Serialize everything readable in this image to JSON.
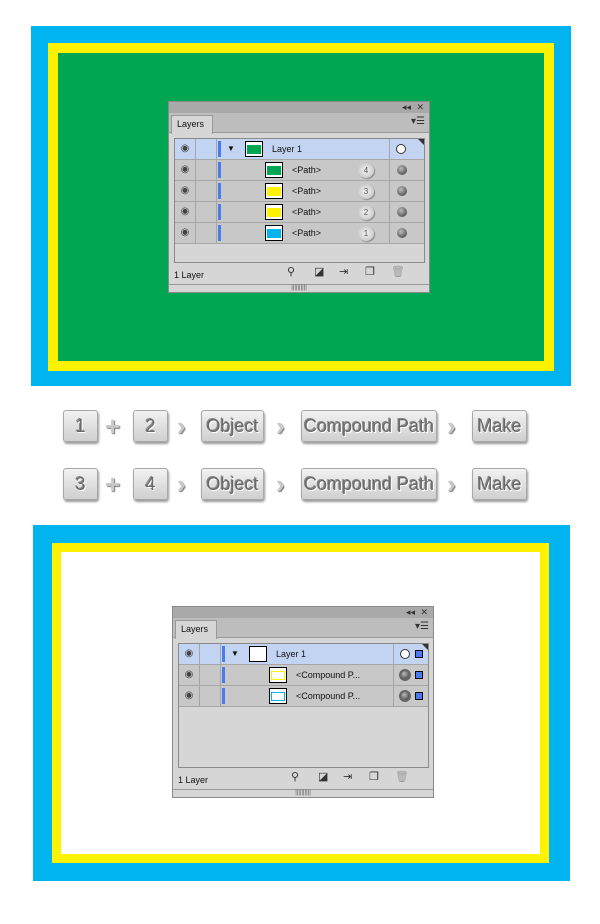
{
  "colors": {
    "blue": "#00b4f0",
    "yellow": "#fff200",
    "green": "#00a651",
    "white": "#ffffff",
    "layer_bar": "#4a7af0"
  },
  "panel_before": {
    "tab": "Layers",
    "footer": "1 Layer",
    "layer": {
      "name": "Layer 1",
      "thumb": "#00a651"
    },
    "rows": [
      {
        "name": "<Path>",
        "badge": "4",
        "thumb": "#00a651"
      },
      {
        "name": "<Path>",
        "badge": "3",
        "thumb": "#fff200"
      },
      {
        "name": "<Path>",
        "badge": "2",
        "thumb": "#fff200"
      },
      {
        "name": "<Path>",
        "badge": "1",
        "thumb": "#00b4f0"
      }
    ]
  },
  "steps": [
    {
      "a": "1",
      "b": "2",
      "menu": "Object",
      "submenu": "Compound Path",
      "action": "Make"
    },
    {
      "a": "3",
      "b": "4",
      "menu": "Object",
      "submenu": "Compound Path",
      "action": "Make"
    }
  ],
  "panel_after": {
    "tab": "Layers",
    "footer": "1 Layer",
    "layer": {
      "name": "Layer 1",
      "thumb": "#ffffff"
    },
    "rows": [
      {
        "name": "<Compound P...",
        "thumb": "#fff200"
      },
      {
        "name": "<Compound P...",
        "thumb": "#00b4f0"
      }
    ]
  }
}
